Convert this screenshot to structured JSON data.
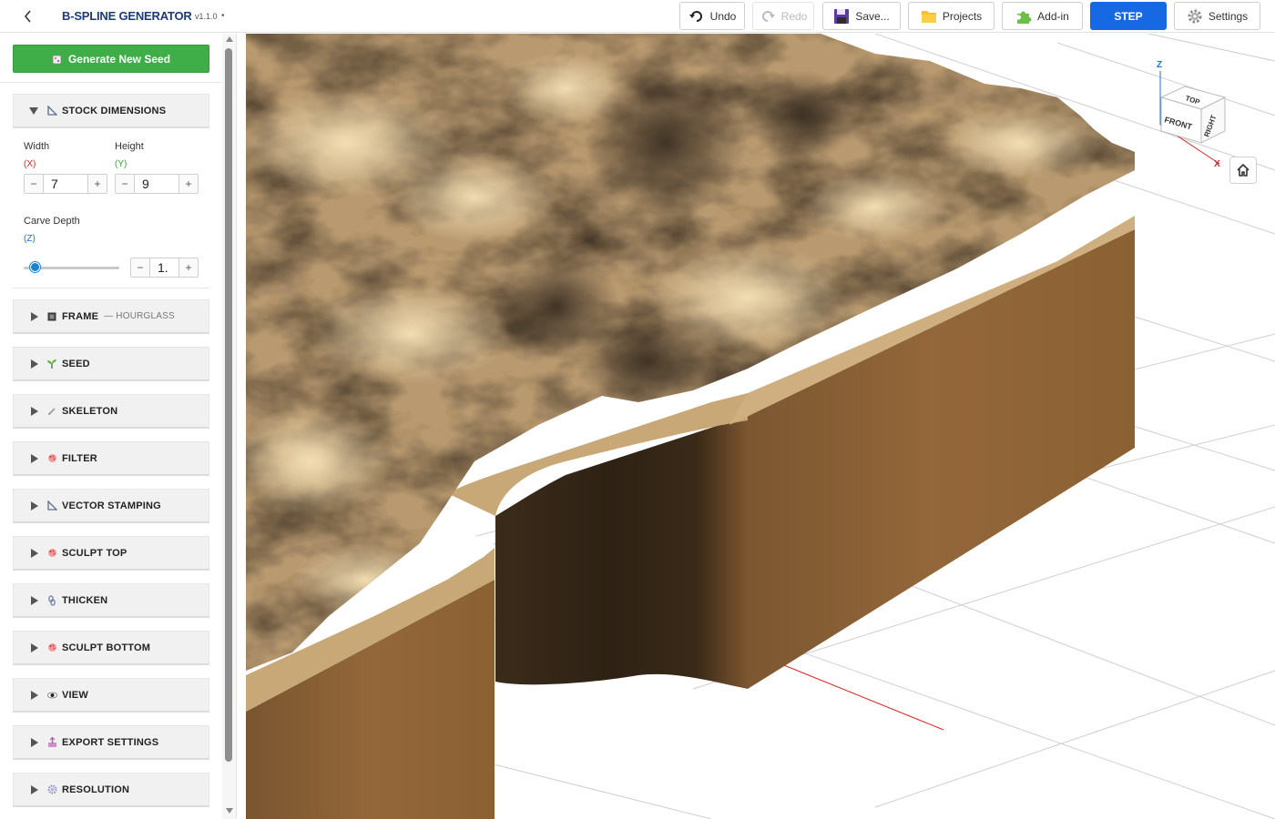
{
  "header": {
    "title": "B-SPLINE GENERATOR",
    "version": "v1.1.0",
    "dirty_marker": "•"
  },
  "toolbar": {
    "undo": "Undo",
    "redo": "Redo",
    "save": "Save...",
    "projects": "Projects",
    "addin": "Add-in",
    "step": "STEP",
    "settings": "Settings"
  },
  "sidebar": {
    "generate_button": "Generate New Seed",
    "stock": {
      "label": "STOCK DIMENSIONS",
      "width_label": "Width",
      "width_axis": "(X)",
      "width_value": "7",
      "height_label": "Height",
      "height_axis": "(Y)",
      "height_value": "9",
      "depth_label": "Carve Depth",
      "depth_axis": "(Z)",
      "depth_value": "1.",
      "depth_slider_fraction": 0.12
    },
    "sections": [
      {
        "label": "FRAME",
        "sub": "— HOURGLASS",
        "icon": "frame-icon"
      },
      {
        "label": "SEED",
        "sub": "",
        "icon": "seedling-icon"
      },
      {
        "label": "SKELETON",
        "sub": "",
        "icon": "pencil-icon"
      },
      {
        "label": "FILTER",
        "sub": "",
        "icon": "palette-icon"
      },
      {
        "label": "VECTOR STAMPING",
        "sub": "",
        "icon": "triangle-ruler-icon"
      },
      {
        "label": "SCULPT TOP",
        "sub": "",
        "icon": "palette-icon"
      },
      {
        "label": "THICKEN",
        "sub": "",
        "icon": "chain-icon"
      },
      {
        "label": "SCULPT BOTTOM",
        "sub": "",
        "icon": "palette-icon"
      },
      {
        "label": "VIEW",
        "sub": "",
        "icon": "eye-icon"
      },
      {
        "label": "EXPORT SETTINGS",
        "sub": "",
        "icon": "export-icon"
      },
      {
        "label": "RESOLUTION",
        "sub": "",
        "icon": "gear-icon"
      }
    ]
  },
  "viewcube": {
    "top": "TOP",
    "front": "FRONT",
    "right": "RIGHT",
    "axis_z": "Z",
    "axis_x": "X"
  },
  "colors": {
    "accent": "#1669e2",
    "generate": "#3fae49",
    "wood_side": "#8f6535",
    "wood_top_light": "#e8cfa0",
    "wood_top_dark": "#4b3c2c",
    "axis_x": "#e02020",
    "axis_z": "#1a6fe0"
  }
}
